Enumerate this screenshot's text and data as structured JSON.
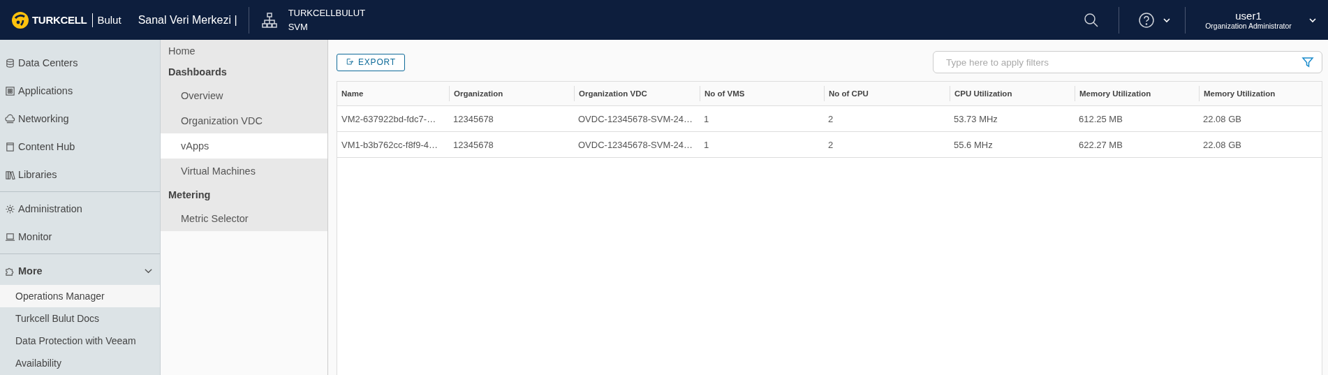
{
  "header": {
    "logo_text": "TURKCELL",
    "brand": "Bulut",
    "title": "Sanal Veri Merkezi |",
    "org": [
      "TURKCELLBULUT",
      "SVM"
    ],
    "user": {
      "name": "user1",
      "role": "Organization Administrator"
    }
  },
  "sidebar": {
    "groups": [
      {
        "items": [
          {
            "label": "Data Centers",
            "selected": false
          },
          {
            "label": "Applications",
            "selected": false
          },
          {
            "label": "Networking",
            "selected": false
          },
          {
            "label": "Content Hub",
            "selected": false
          },
          {
            "label": "Libraries",
            "selected": false
          }
        ]
      },
      {
        "items": [
          {
            "label": "Administration",
            "selected": false
          },
          {
            "label": "Monitor",
            "selected": false
          }
        ]
      }
    ],
    "more": {
      "label": "More",
      "expanded": true,
      "items": [
        {
          "label": "Operations Manager",
          "selected": true
        },
        {
          "label": "Turkcell Bulut Docs",
          "selected": false
        },
        {
          "label": "Data Protection with Veeam",
          "selected": false
        },
        {
          "label": "Availability",
          "selected": false
        }
      ]
    }
  },
  "subnav": [
    {
      "kind": "link",
      "label": "Home",
      "selected": false
    },
    {
      "kind": "heading",
      "label": "Dashboards"
    },
    {
      "kind": "child",
      "label": "Overview",
      "selected": false
    },
    {
      "kind": "child",
      "label": "Organization VDC",
      "selected": false
    },
    {
      "kind": "child",
      "label": "vApps",
      "selected": true
    },
    {
      "kind": "child",
      "label": "Virtual Machines",
      "selected": false
    },
    {
      "kind": "heading",
      "label": "Metering"
    },
    {
      "kind": "child",
      "label": "Metric Selector",
      "selected": false
    }
  ],
  "toolbar": {
    "export": "EXPORT",
    "filter": {
      "placeholder": "Type here to apply filters"
    }
  },
  "table": {
    "columns": [
      "Name",
      "Organization",
      "Organization VDC",
      "No of VMS",
      "No of CPU",
      "CPU Utilization",
      "Memory Utilization",
      "Memory Utilization"
    ],
    "rows": [
      [
        "VM2-637922bd-fdc7-…",
        "12345678",
        "OVDC-12345678-SVM-24…",
        "1",
        "2",
        "53.73 MHz",
        "612.25 MB",
        "22.08 GB"
      ],
      [
        "VM1-b3b762cc-f8f9-4…",
        "12345678",
        "OVDC-12345678-SVM-24…",
        "1",
        "2",
        "55.6 MHz",
        "622.27 MB",
        "22.08 GB"
      ]
    ]
  }
}
